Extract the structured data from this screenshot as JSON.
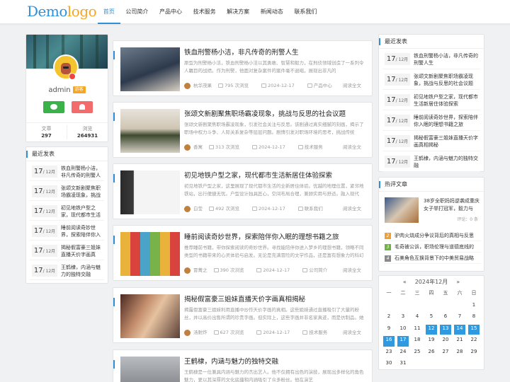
{
  "header": {
    "logo": {
      "part1": "Demo",
      "part2": "logo"
    },
    "nav": [
      "首页",
      "公司简介",
      "产品中心",
      "技术服务",
      "解决方案",
      "新闻动态",
      "联系我们"
    ]
  },
  "profile": {
    "username": "admin",
    "level": "游客",
    "stats": [
      {
        "label": "文章",
        "value": "297"
      },
      {
        "label": "浏览",
        "value": "264931"
      }
    ]
  },
  "left_recent": {
    "title": "最近发表",
    "items": [
      {
        "day": "17",
        "month": "/ 12月",
        "text": "铁血刑警杨小洁，非凡传奇的刑警人"
      },
      {
        "day": "17",
        "month": "/ 12月",
        "text": "张颂文新剧聚焦职场霸凌现象，挑战"
      },
      {
        "day": "17",
        "month": "/ 12月",
        "text": "初见地铁户型之家，现代都市生活"
      },
      {
        "day": "17",
        "month": "/ 12月",
        "text": "睡前阅读奇妙世界，探索陪伴你入"
      },
      {
        "day": "17",
        "month": "/ 12月",
        "text": "揭秘假富豪三姐妹直播天价字画真"
      },
      {
        "day": "17",
        "month": "/ 12月",
        "text": "王鹤棣，内涵与魅力的独特交融"
      }
    ]
  },
  "articles": [
    {
      "title": "铁血刑警杨小洁，非凡传奇的刑警人生",
      "desc": "原型为刑警杨小洁，铁血刑警杨小洁以其勇敢、智慧和毅力，在刑侦领域创造了一系列令人瞩目的战绩。作为刑警，他面对复杂案件的案件毫不退缩，展现出非凡的",
      "author": "杭华茂果",
      "views": "795 次浏览",
      "date": "2024-12-17",
      "category": "产品中心",
      "more": "阅读全文"
    },
    {
      "title": "张颂文新剧聚焦职场霸凌现象，挑战与反思的社会议题",
      "desc": "张颂文新剧聚焦职场霸凌现象，引发社会关注与反思。该剧通过真实细腻的刻画，揭示了职场中权力斗争、人际关系复杂等层层问题。剧情引发对职场环境的思考，挑战传统",
      "author": "香寓",
      "views": "313 次浏览",
      "date": "2024-12-17",
      "category": "技术服务",
      "more": "阅读全文"
    },
    {
      "title": "初见地铁户型之家，现代都市生活新居住体验探索",
      "desc": "初见地铁户型之家，这里展现了现代都市生活的全新居住体验。优越的地理位置，紧邻地铁站，出行便捷无忧。户型设计独具匠心，空间布局合理，兼顾实用与舒适。融入现代",
      "author": "白莹",
      "views": "492 次浏览",
      "date": "2024-12-17",
      "category": "联系我们",
      "more": "阅读全文"
    },
    {
      "title": "睡前阅读奇妙世界，探索陪伴你入眠的理想书籍之旅",
      "desc": "推荐睡前书籍，带你探索阅读的奇妙世界。寻找能陪伴你进入梦乡的理想书籍，领略不同类型的书籍带来的心灵体验与启发。无论是充满冒险的文学作品，还是富有想象力的科幻",
      "author": "冒菁之",
      "views": "390 次浏览",
      "date": "2024-12-17",
      "category": "公司简介",
      "more": "阅读全文"
    },
    {
      "title": "揭秘假富豪三姐妹直播天价字画真相揭秘",
      "desc": "揭露假富豪三姐妹利用直播中炒作天价字画的真相。这些姐妹通过直播吸引了大量的粉丝，并以高价出售所谓的珍贵字画。但实际上，这些字画并非名家真迹，而是仿制品。她们",
      "author": "汤耐炸",
      "views": "627 次浏览",
      "date": "2024-12-17",
      "category": "技术服务",
      "more": "阅读全文"
    },
    {
      "title": "王鹤棣，内涵与魅力的独特交融",
      "desc": "王鹤棣是一位兼具内涵与魅力的杰出艺人。他不仅拥有出色的演技，展现出多样化的角色魅力，更以其深厚的文化底蕴和内涵吸引了众多粉丝。他在演艺",
      "author": "",
      "views": "",
      "date": "",
      "category": "",
      "more": ""
    }
  ],
  "right_recent": {
    "title": "最近发表",
    "items": [
      {
        "day": "17",
        "month": "/ 12月",
        "text": "铁血刑警杨小洁，非凡传奇的刑警人生"
      },
      {
        "day": "17",
        "month": "/ 12月",
        "text": "张颂文新剧聚焦职场霸凌现象，挑战与反思的社会议题"
      },
      {
        "day": "17",
        "month": "/ 12月",
        "text": "初见地铁户型之家，现代都市生活新居住体验探索"
      },
      {
        "day": "17",
        "month": "/ 12月",
        "text": "睡前阅读奇妙世界，探索陪伴你入眠的理想书籍之旅"
      },
      {
        "day": "17",
        "month": "/ 12月",
        "text": "揭秘假富豪三姐妹直播天价字画真相揭秘"
      },
      {
        "day": "17",
        "month": "/ 12月",
        "text": "王鹤棣，内涵与魅力的独特交融"
      }
    ]
  },
  "hot": {
    "title": "热评文章",
    "top_title": "38岁全职妈妈逆袭成重庆女子举打冠军，毅力与",
    "top_meta": "评论：0 条",
    "list": [
      {
        "n": "2",
        "color": "#f0a030",
        "text": "驴肉火烧成分争议背后的真相与反思"
      },
      {
        "n": "3",
        "color": "#6cb33f",
        "text": "毛奇被公诉，职场伦理与道德底线的"
      },
      {
        "n": "4",
        "color": "#8a8a8a",
        "text": "石美角色互换背景下的中美贸易战略"
      }
    ]
  },
  "calendar": {
    "prev": "«",
    "title": "2024年12月",
    "next": "»",
    "weekdays": [
      "一",
      "二",
      "三",
      "四",
      "五",
      "六",
      "日"
    ],
    "days": [
      "",
      "",
      "",
      "",
      "",
      "",
      "1",
      "2",
      "3",
      "4",
      "5",
      "6",
      "7",
      "8",
      "9",
      "10",
      "11",
      "12",
      "13",
      "14",
      "15",
      "16",
      "17",
      "18",
      "19",
      "20",
      "21",
      "22",
      "23",
      "24",
      "25",
      "26",
      "27",
      "28",
      "29",
      "30",
      "31",
      "",
      "",
      "",
      "",
      ""
    ],
    "highlighted": [
      "12",
      "13",
      "14",
      "15",
      "16"
    ],
    "today": "17"
  }
}
